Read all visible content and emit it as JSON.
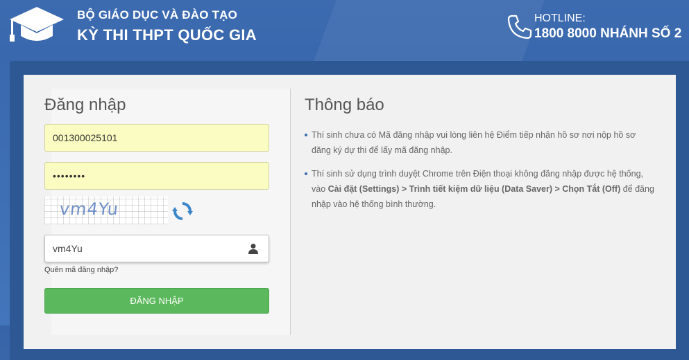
{
  "header": {
    "ministry": "BỘ GIÁO DỤC VÀ ĐÀO TẠO",
    "exam_title": "KỲ THI THPT QUỐC GIA",
    "hotline_label": "HOTLINE:",
    "hotline_number": "1800 8000 NHÁNH SỐ 2"
  },
  "login": {
    "title": "Đăng nhập",
    "username_value": "001300025101",
    "password_value": "••••••••",
    "captcha_text": "vm4Yu",
    "captcha_input_value": "vm4Yu",
    "forgot_link": "Quên mã đăng nhập?",
    "submit_label": "ĐĂNG NHẬP",
    "submit_color": "#5cb85c"
  },
  "notice": {
    "title": "Thông báo",
    "item1": "Thí sinh chưa có Mã đăng nhập vui lòng liên hệ Điểm tiếp nhận hồ sơ nơi nộp hồ sơ đăng ký dự thi để lấy mã đăng nhập.",
    "item2_prefix": "Thí sinh sử dụng trình duyệt Chrome trên Điện thoại không đăng nhập được hệ thống, vào ",
    "item2_bold": "Cài đặt (Settings) > Trình tiết kiệm dữ liệu (Data Saver) > Chọn Tắt (Off)",
    "item2_suffix": " để đăng nhập vào hệ thống bình thường."
  },
  "icons": {
    "logo": "graduation-cap-icon",
    "phone": "phone-icon",
    "refresh": "refresh-icon",
    "user": "user-icon"
  },
  "colors": {
    "background": "#3c6bb0",
    "autofill": "#fafcc1",
    "bullet": "#3a6cb0"
  }
}
